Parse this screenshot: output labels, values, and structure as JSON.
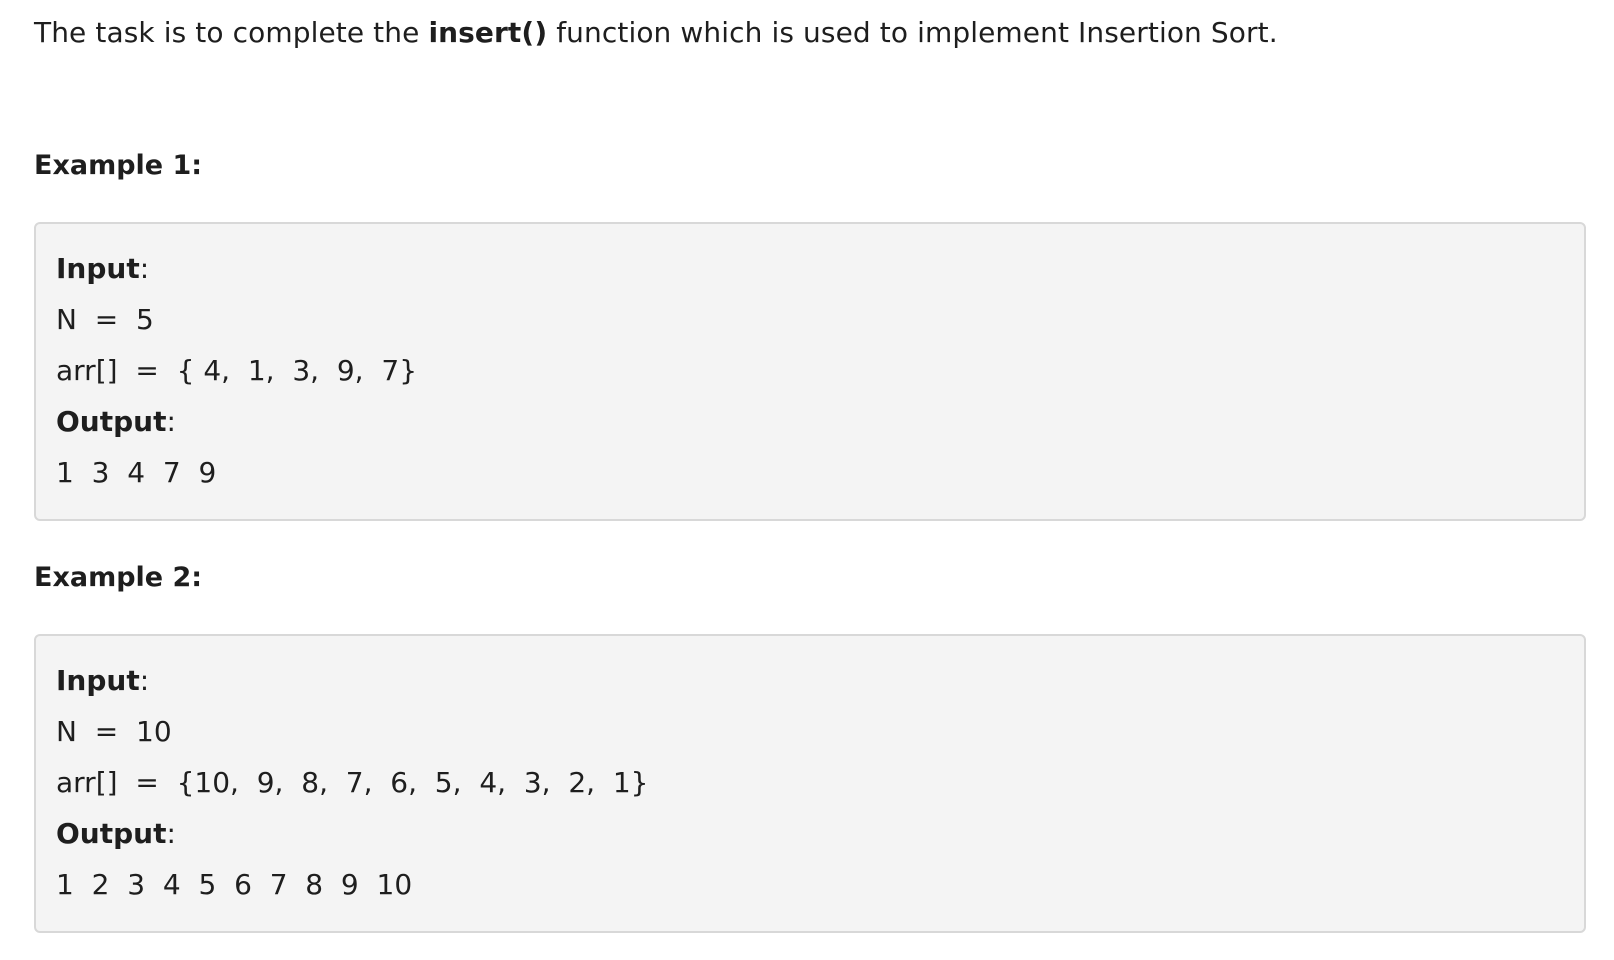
{
  "intro": {
    "prefix": "The task is to complete the ",
    "function_name": "insert()",
    "suffix": " function which is used to implement Insertion Sort."
  },
  "examples": [
    {
      "heading": "Example 1:",
      "input_label": "Input",
      "n_line": "N  =  5",
      "arr_line": "arr[]  =  { 4,  1,  3,  9,  7}",
      "output_label": "Output",
      "output_line": "1  3  4  7  9"
    },
    {
      "heading": "Example 2:",
      "input_label": "Input",
      "n_line": "N  =  10",
      "arr_line": "arr[]  =  {10,  9,  8,  7,  6,  5,  4,  3,  2,  1}",
      "output_label": "Output",
      "output_line": "1  2  3  4  5  6  7  8  9  10"
    }
  ],
  "colon": ":"
}
